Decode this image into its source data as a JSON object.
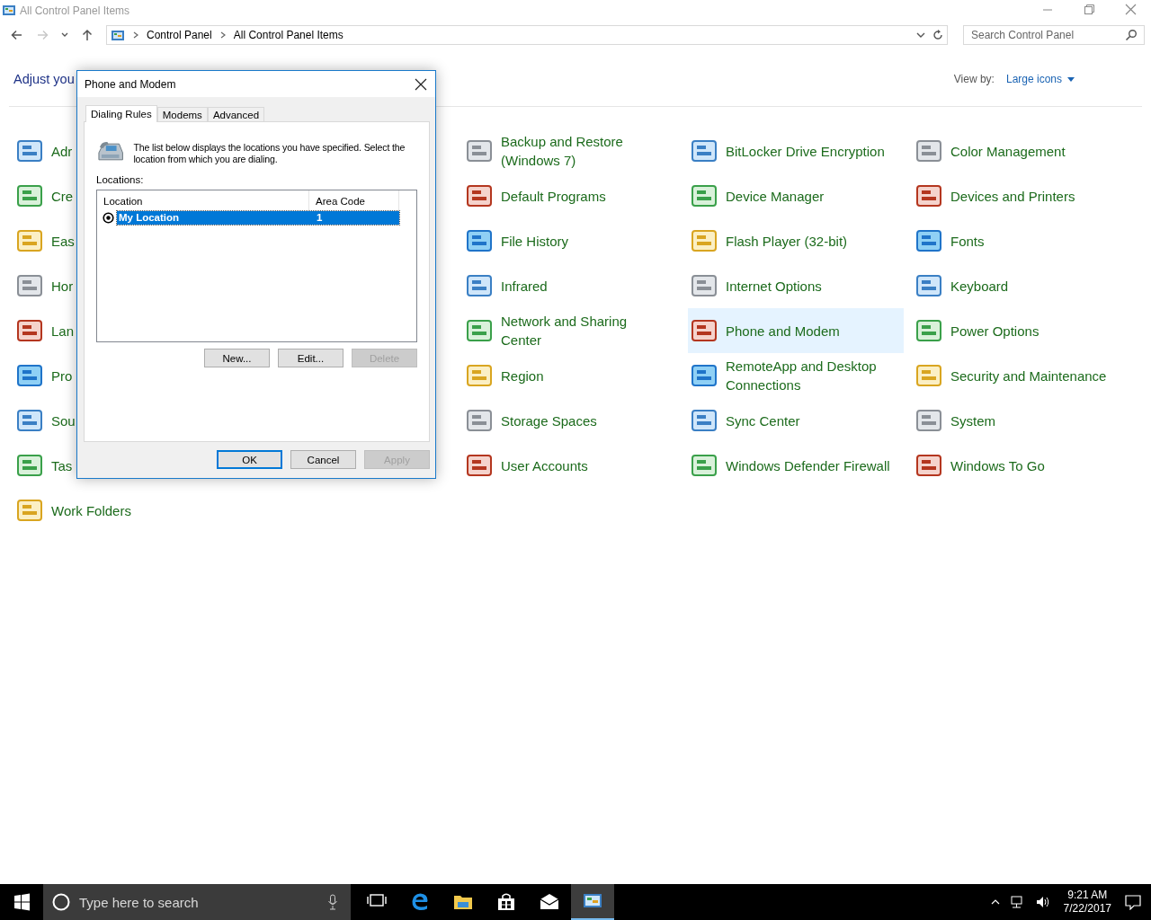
{
  "window": {
    "title": "All Control Panel Items"
  },
  "navigation": [
    {
      "kind": "back",
      "disabled": false
    },
    {
      "kind": "forward",
      "disabled": true
    },
    {
      "kind": "recent",
      "disabled": false
    },
    {
      "kind": "up",
      "disabled": false
    }
  ],
  "address_bar": {
    "breadcrumbs": [
      "Control Panel",
      "All Control Panel Items"
    ]
  },
  "search": {
    "placeholder": "Search Control Panel"
  },
  "heading": "Adjust you",
  "view_by": {
    "label": "View by:",
    "value": "Large icons"
  },
  "item_columns": [
    {
      "items": [
        {
          "label": "Adr",
          "selected": false
        },
        {
          "label": "Cre",
          "selected": false
        },
        {
          "label": "Eas",
          "selected": false
        },
        {
          "label": "Hor",
          "selected": false
        },
        {
          "label": "Lan",
          "selected": false
        },
        {
          "label": "Pro",
          "selected": false
        },
        {
          "label": "Sou",
          "selected": false
        },
        {
          "label": "Tas",
          "selected": false
        },
        {
          "label": "Work Folders",
          "selected": false
        }
      ]
    },
    {
      "items": [
        {
          "label": "Backup and Restore (Windows 7)",
          "selected": false
        },
        {
          "label": "Default Programs",
          "selected": false
        },
        {
          "label": "File History",
          "selected": false
        },
        {
          "label": "Infrared",
          "selected": false
        },
        {
          "label": "Network and Sharing Center",
          "selected": false
        },
        {
          "label": "Region",
          "selected": false
        },
        {
          "label": "Storage Spaces",
          "selected": false
        },
        {
          "label": "User Accounts",
          "selected": false
        }
      ]
    },
    {
      "items": [
        {
          "label": "BitLocker Drive Encryption",
          "selected": false
        },
        {
          "label": "Device Manager",
          "selected": false
        },
        {
          "label": "Flash Player (32-bit)",
          "selected": false
        },
        {
          "label": "Internet Options",
          "selected": false
        },
        {
          "label": "Phone and Modem",
          "selected": true
        },
        {
          "label": "RemoteApp and Desktop Connections",
          "selected": false
        },
        {
          "label": "Sync Center",
          "selected": false
        },
        {
          "label": "Windows Defender Firewall",
          "selected": false
        }
      ]
    },
    {
      "items": [
        {
          "label": "Color Management",
          "selected": false
        },
        {
          "label": "Devices and Printers",
          "selected": false
        },
        {
          "label": "Fonts",
          "selected": false
        },
        {
          "label": "Keyboard",
          "selected": false
        },
        {
          "label": "Power Options",
          "selected": false
        },
        {
          "label": "Security and Maintenance",
          "selected": false
        },
        {
          "label": "System",
          "selected": false
        },
        {
          "label": "Windows To Go",
          "selected": false
        }
      ]
    }
  ],
  "dialog": {
    "title": "Phone and Modem",
    "tabs": [
      {
        "label": "Dialing Rules",
        "selected": true
      },
      {
        "label": "Modems",
        "selected": false
      },
      {
        "label": "Advanced",
        "selected": false
      }
    ],
    "description": "The list below displays the locations you have specified. Select the location from which you are dialing.",
    "locations_label": "Locations:",
    "columns": [
      "Location",
      "Area Code"
    ],
    "rows": [
      {
        "location": "My Location",
        "area_code": "1",
        "selected": true,
        "default": true
      }
    ],
    "buttons": [
      {
        "label": "New...",
        "disabled": false
      },
      {
        "label": "Edit...",
        "disabled": false
      },
      {
        "label": "Delete",
        "disabled": true
      }
    ],
    "footer_buttons": [
      {
        "label": "OK",
        "default": true,
        "disabled": false
      },
      {
        "label": "Cancel",
        "default": false,
        "disabled": false
      },
      {
        "label": "Apply",
        "default": false,
        "disabled": true
      }
    ]
  },
  "taskbar": {
    "search_placeholder": "Type here to search",
    "apps": [
      {
        "kind": "taskview",
        "active": false
      },
      {
        "kind": "edge",
        "active": false
      },
      {
        "kind": "explorer",
        "active": false
      },
      {
        "kind": "store",
        "active": false
      },
      {
        "kind": "mail",
        "active": false
      },
      {
        "kind": "controlpanel",
        "active": true
      }
    ],
    "time": "9:21 AM",
    "date": "7/22/2017"
  }
}
